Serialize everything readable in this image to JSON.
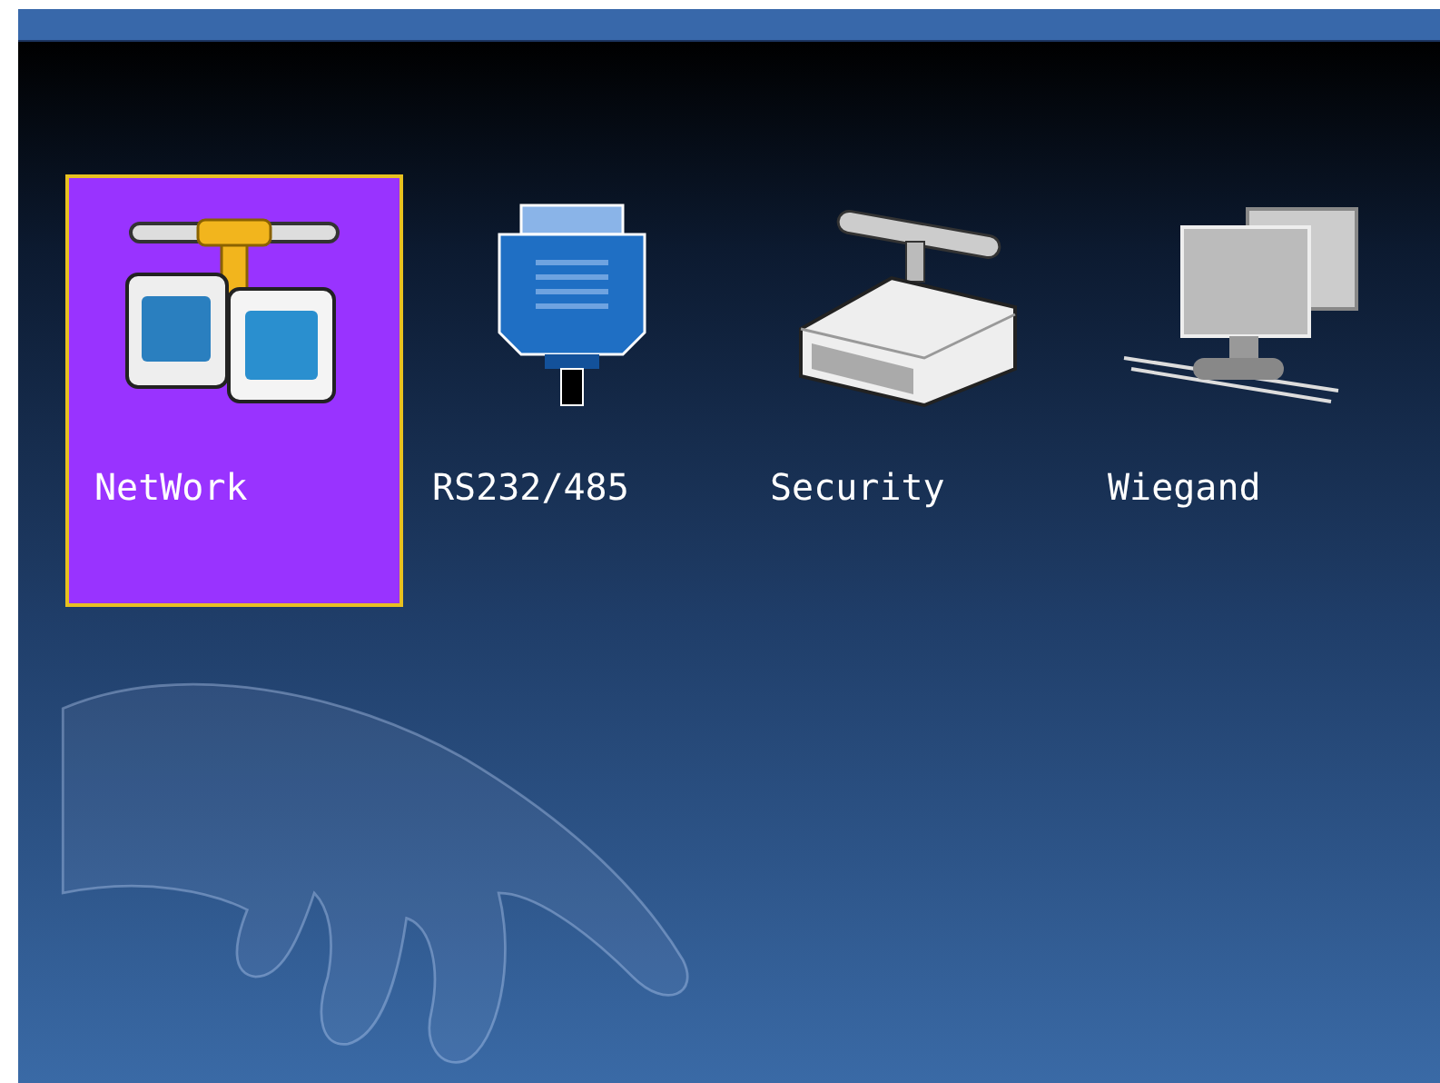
{
  "menu_items": [
    {
      "label": "NetWork",
      "kind": "network",
      "selected": true
    },
    {
      "label": "RS232/485",
      "kind": "serial",
      "selected": false
    },
    {
      "label": "Security",
      "kind": "security",
      "selected": false
    },
    {
      "label": "Wiegand",
      "kind": "wiegand",
      "selected": false
    }
  ]
}
